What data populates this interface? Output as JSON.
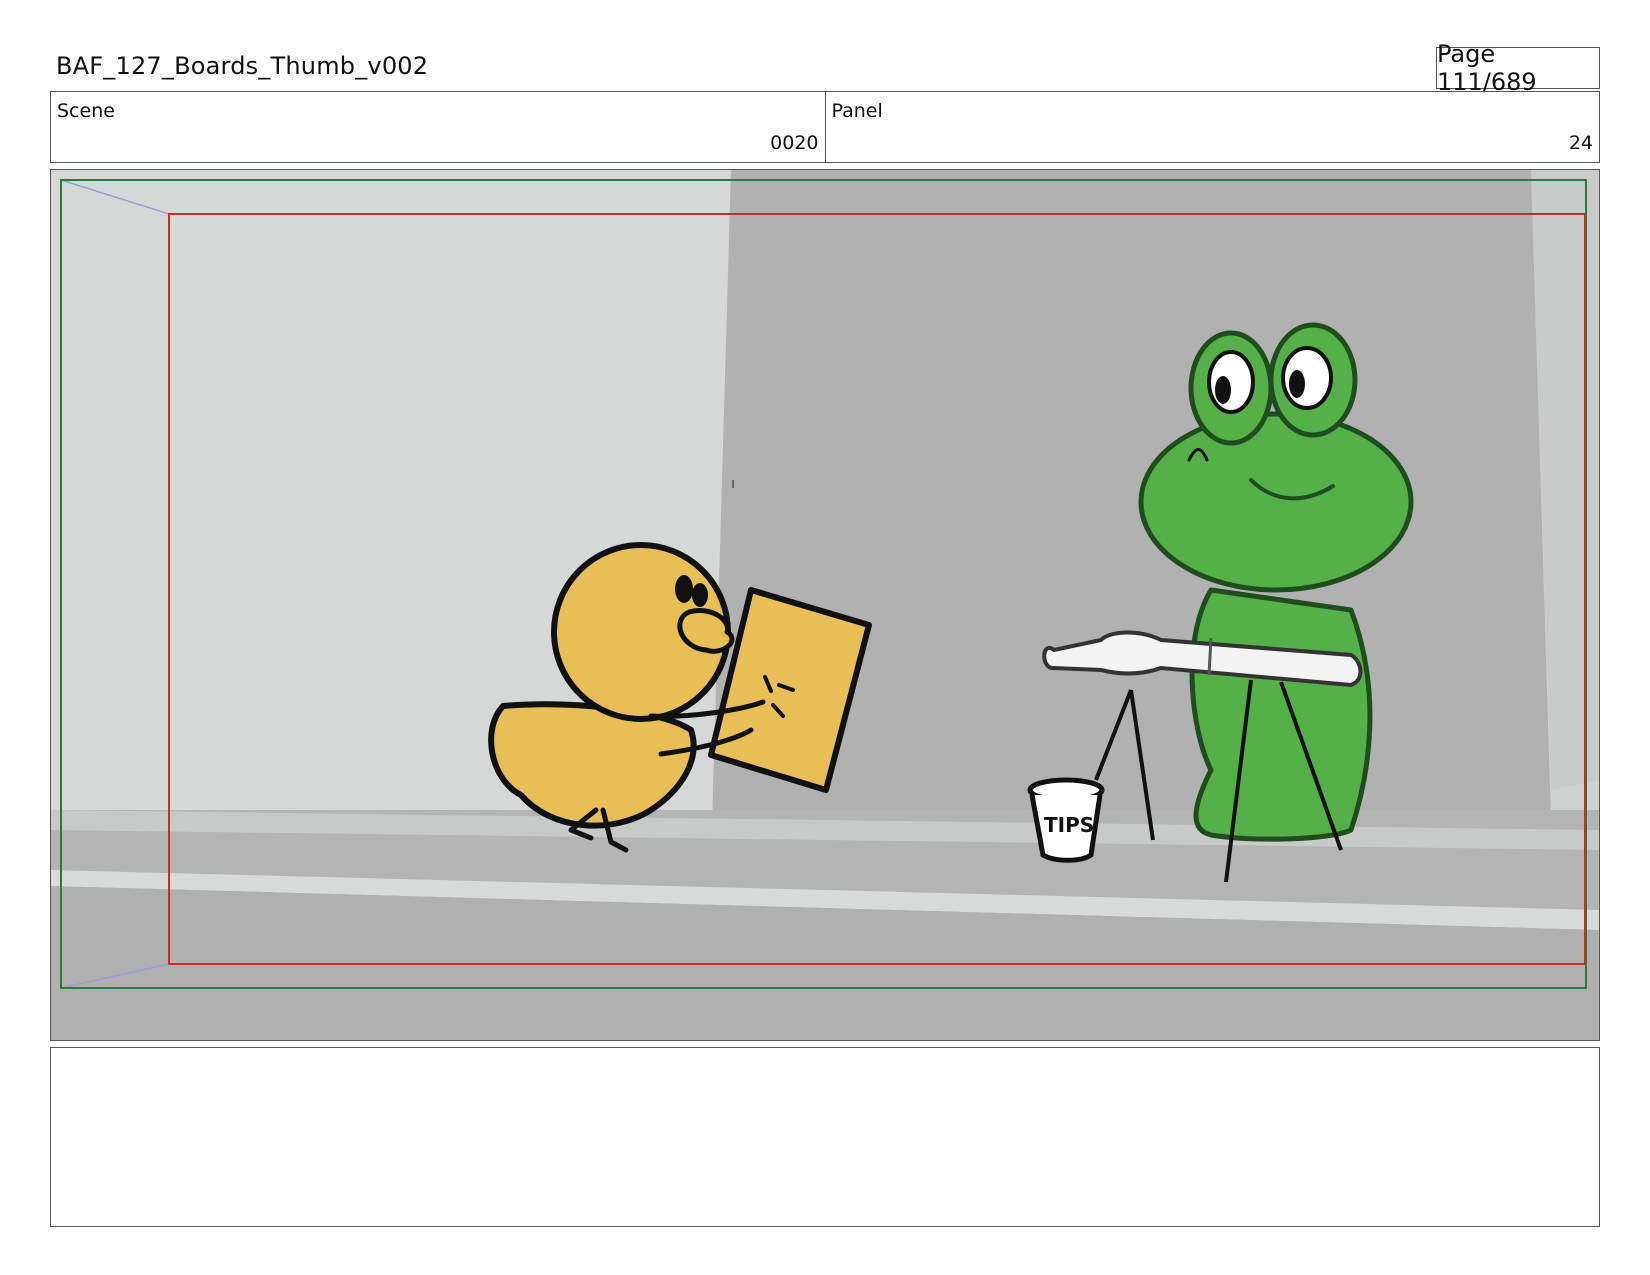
{
  "header": {
    "title": "BAF_127_Boards_Thumb_v002",
    "page": "Page 111/689"
  },
  "info": {
    "scene_label": "Scene",
    "scene_value": "0020",
    "panel_label": "Panel",
    "panel_value": "24"
  },
  "frame": {
    "cup_label": "TIPS",
    "colors": {
      "duck": "#e8bf57",
      "frog": "#56b04a",
      "wall_light": "#d5d6d6",
      "wall_dark": "#b2b2b2",
      "safe_frame": "#cc2a2a",
      "camera_frame": "#2a7a3a"
    }
  },
  "notes": {
    "text": ""
  }
}
